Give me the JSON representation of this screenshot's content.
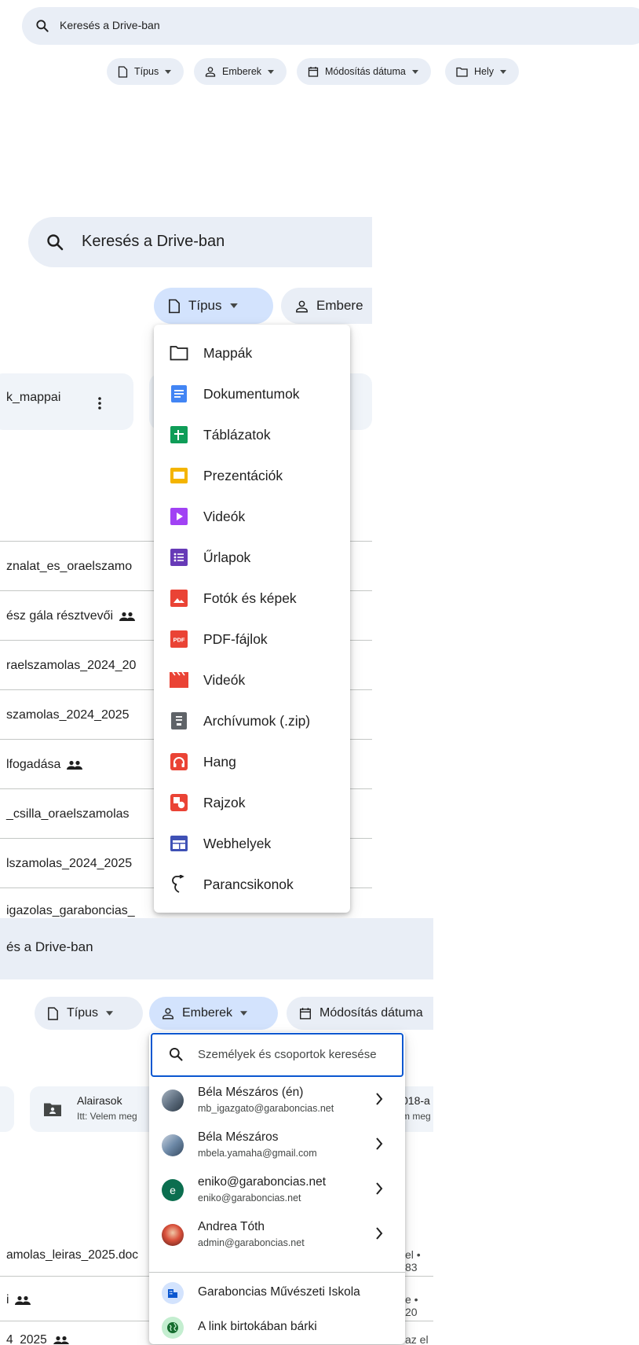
{
  "section1": {
    "search_placeholder": "Keresés a Drive-ban",
    "chips": [
      "Típus",
      "Emberek",
      "Módosítás dátuma",
      "Hely"
    ]
  },
  "section2": {
    "search_placeholder": "Keresés a Drive-ban",
    "chip_type": "Típus",
    "chip_people": "Embere",
    "tile_label": "k_mappai",
    "rows": [
      "znalat_es_oraelszamo",
      "ész gála résztvevői",
      "raelszamolas_2024_20",
      "szamolas_2024_2025",
      "lfogadása",
      "_csilla_oraelszamolas",
      "lszamolas_2024_2025",
      "igazolas_garaboncias_"
    ],
    "type_menu": [
      {
        "label": "Mappák",
        "icon": "folder-icon",
        "color": "#1f1f1f"
      },
      {
        "label": "Dokumentumok",
        "icon": "docs-icon",
        "color": "#4285f4"
      },
      {
        "label": "Táblázatok",
        "icon": "sheets-icon",
        "color": "#0f9d58"
      },
      {
        "label": "Prezentációk",
        "icon": "slides-icon",
        "color": "#f4b400"
      },
      {
        "label": "Videók",
        "icon": "vids-icon",
        "color": "#a142f4"
      },
      {
        "label": "Űrlapok",
        "icon": "forms-icon",
        "color": "#673ab7"
      },
      {
        "label": "Fotók és képek",
        "icon": "image-icon",
        "color": "#ea4335"
      },
      {
        "label": "PDF-fájlok",
        "icon": "pdf-icon",
        "color": "#ea4335"
      },
      {
        "label": "Videók",
        "icon": "video-file-icon",
        "color": "#ea4335"
      },
      {
        "label": "Archívumok (.zip)",
        "icon": "archive-icon",
        "color": "#5f6368"
      },
      {
        "label": "Hang",
        "icon": "audio-icon",
        "color": "#ea4335"
      },
      {
        "label": "Rajzok",
        "icon": "drawings-icon",
        "color": "#ea4335"
      },
      {
        "label": "Webhelyek",
        "icon": "sites-icon",
        "color": "#3f51b5"
      },
      {
        "label": "Parancsikonok",
        "icon": "shortcut-icon",
        "color": "#1f1f1f"
      }
    ]
  },
  "section3": {
    "search_placeholder": "és a Drive-ban",
    "chip_type": "Típus",
    "chip_people": "Emberek",
    "chip_date": "Módosítás dátuma",
    "folder_title": "Alairasok",
    "folder_sub": "Itt: Velem meg",
    "folder2_title": "018-a",
    "folder2_sub": "m meg",
    "rows": [
      {
        "name": "amolas_leiras_2025.doc",
        "right": "el • 83"
      },
      {
        "name": "i",
        "right": "e • 20"
      },
      {
        "name": "4_2025",
        "right": "az el"
      }
    ],
    "people_search_placeholder": "Személyek és csoportok keresése",
    "people": [
      {
        "name": "Béla Mészáros (én)",
        "email": "mb_igazgato@garaboncias.net",
        "avatar": "photo"
      },
      {
        "name": "Béla Mészáros",
        "email": "mbela.yamaha@gmail.com",
        "avatar": "photo"
      },
      {
        "name": "eniko@garaboncias.net",
        "email": "eniko@garaboncias.net",
        "avatar": "letter",
        "initial": "e"
      },
      {
        "name": "Andrea Tóth",
        "email": "admin@garaboncias.net",
        "avatar": "photo"
      }
    ],
    "groups": [
      {
        "name": "Garaboncias Művészeti Iskola",
        "icon": "domain-icon"
      },
      {
        "name": "A link birtokában bárki",
        "icon": "globe-icon"
      }
    ]
  },
  "colors": {
    "accent": "#0b57d0",
    "surface": "#e9eef6",
    "chip_active": "#d3e3fd",
    "divider": "#c4c7c5"
  }
}
